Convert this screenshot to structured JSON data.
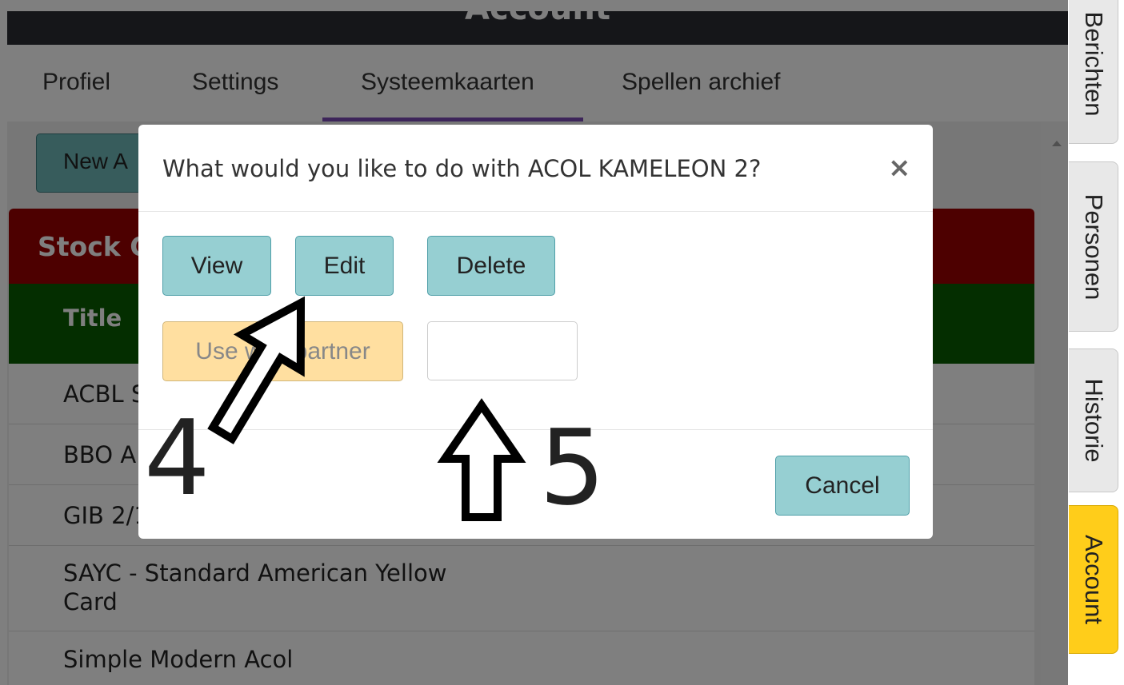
{
  "header": {
    "title": "Account"
  },
  "tabs": [
    {
      "label": "Profiel"
    },
    {
      "label": "Settings"
    },
    {
      "label": "Systeemkaarten",
      "active": true
    },
    {
      "label": "Spellen archief"
    }
  ],
  "content": {
    "new_button_label": "New A",
    "stock_heading": "Stock C",
    "table_header": "Title",
    "rows": [
      {
        "title": "ACBL S"
      },
      {
        "title": "BBO A"
      },
      {
        "title": "GIB 2/1"
      },
      {
        "title_line1": "SAYC - Standard American Yellow",
        "title_line2": "Card"
      },
      {
        "title": "Simple Modern Acol"
      }
    ]
  },
  "modal": {
    "title": "What would you like to do with ACOL KAMELEON 2?",
    "close_icon": "×",
    "view_label": "View",
    "edit_label": "Edit",
    "delete_label": "Delete",
    "use_with_partner_label": "Use with partner",
    "partner_input_value": "",
    "cancel_label": "Cancel"
  },
  "annotations": {
    "label_4": "4",
    "label_5": "5"
  },
  "side_tabs": [
    {
      "label": "Berichten"
    },
    {
      "label": "Personen"
    },
    {
      "label": "Historie"
    },
    {
      "label": "Account",
      "active": true
    }
  ],
  "colors": {
    "header_bg": "#2b2d33",
    "tab_underline": "#7a4bb5",
    "stock_bar": "#9b0000",
    "title_bar": "#085c00",
    "button_teal": "#96cfd2",
    "button_yellow": "#ffdfa0",
    "active_side_tab": "#ffcd1a"
  }
}
